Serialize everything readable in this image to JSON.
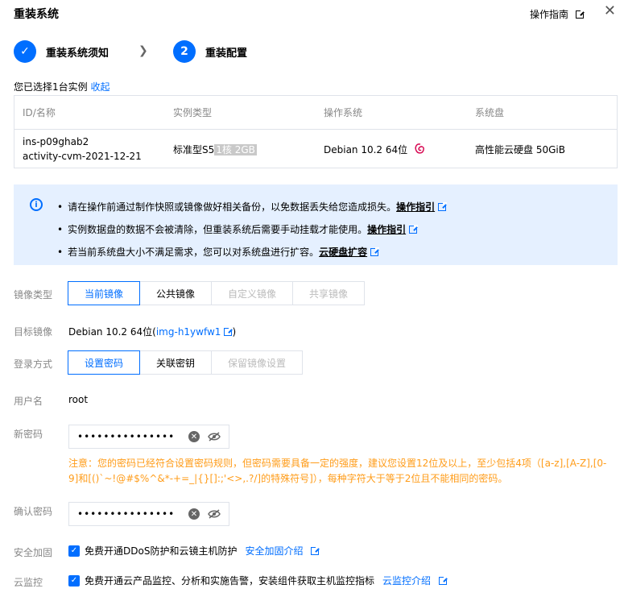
{
  "header": {
    "title": "重装系统",
    "guide_label": "操作指南",
    "close_icon": "close-icon"
  },
  "steps": [
    {
      "label": "重装系统须知",
      "done": true
    },
    {
      "number": "2",
      "label": "重装配置"
    }
  ],
  "selection": {
    "text": "您已选择1台实例",
    "collapse_label": "收起"
  },
  "table": {
    "columns": [
      "ID/名称",
      "实例类型",
      "操作系统",
      "系统盘"
    ],
    "row": {
      "id": "ins-p09ghab2",
      "name": "activity-cvm-2021-12-21",
      "type": "标准型S5",
      "type_spec": "1核 2GB",
      "os": "Debian 10.2 64位",
      "disk": "高性能云硬盘 50GiB"
    }
  },
  "notice": {
    "items": [
      {
        "text": "请在操作前通过制作快照或镜像做好相关备份，以免数据丢失给您造成损失。",
        "link": "操作指引"
      },
      {
        "text": "实例数据盘的数据不会被清除，但重装系统后需要手动挂载才能使用。",
        "link": "操作指引"
      },
      {
        "text": "若当前系统盘大小不满足需求，您可以对系统盘进行扩容。",
        "link": "云硬盘扩容"
      }
    ]
  },
  "image_type": {
    "label": "镜像类型",
    "options": [
      "当前镜像",
      "公共镜像",
      "自定义镜像",
      "共享镜像"
    ]
  },
  "target_image": {
    "label": "目标镜像",
    "value": "Debian 10.2 64位(",
    "link": "img-h1ywfw1",
    "suffix": ")"
  },
  "login": {
    "label": "登录方式",
    "options": [
      "设置密码",
      "关联密钥",
      "保留镜像设置"
    ]
  },
  "username": {
    "label": "用户名",
    "value": "root"
  },
  "password": {
    "label": "新密码",
    "value": "•••••••••••••••"
  },
  "warning": "注意：您的密码已经符合设置密码规则，但密码需要具备一定的强度，建议您设置12位及以上，至少包括4项（[a-z],[A-Z],[0-9]和[()`~!@#$%^&*-+=_|{}[]:;'<>,.?/]的特殊符号]），每种字符大于等于2位且不能相同的密码。",
  "confirm": {
    "label": "确认密码",
    "value": "•••••••••••••••"
  },
  "security": {
    "label": "安全加固",
    "text": "免费开通DDoS防护和云镜主机防护",
    "link": "安全加固介绍"
  },
  "monitor": {
    "label": "云监控",
    "text": "免费开通云产品监控、分析和实施告警，安装组件获取主机监控指标",
    "link": "云监控介绍"
  }
}
